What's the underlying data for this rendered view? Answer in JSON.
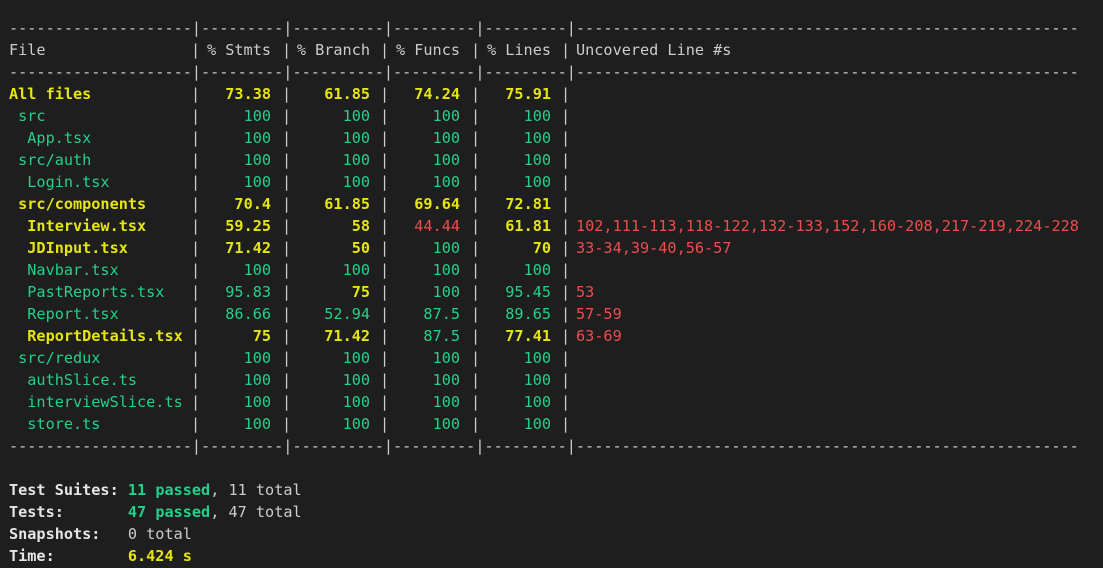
{
  "table": {
    "rule_line": "--------------------|---------|----------|---------|---------|-------------------------------------------------------",
    "headers": [
      "File",
      "% Stmts",
      "% Branch",
      "% Funcs",
      "% Lines",
      "Uncovered Line #s"
    ],
    "rows": [
      {
        "file": "All files",
        "stmts": "73.38",
        "branch": "61.85",
        "funcs": "74.24",
        "lines": "75.91",
        "uncovered": "",
        "colors": {
          "file": "yellow",
          "stmts": "yellow",
          "branch": "yellow",
          "funcs": "yellow",
          "lines": "yellow",
          "uncovered": "red"
        }
      },
      {
        "file": " src",
        "stmts": "100",
        "branch": "100",
        "funcs": "100",
        "lines": "100",
        "uncovered": "",
        "colors": {
          "file": "green",
          "stmts": "green",
          "branch": "green",
          "funcs": "green",
          "lines": "green",
          "uncovered": "red"
        }
      },
      {
        "file": "  App.tsx",
        "stmts": "100",
        "branch": "100",
        "funcs": "100",
        "lines": "100",
        "uncovered": "",
        "colors": {
          "file": "green",
          "stmts": "green",
          "branch": "green",
          "funcs": "green",
          "lines": "green",
          "uncovered": "red"
        }
      },
      {
        "file": " src/auth",
        "stmts": "100",
        "branch": "100",
        "funcs": "100",
        "lines": "100",
        "uncovered": "",
        "colors": {
          "file": "green",
          "stmts": "green",
          "branch": "green",
          "funcs": "green",
          "lines": "green",
          "uncovered": "red"
        }
      },
      {
        "file": "  Login.tsx",
        "stmts": "100",
        "branch": "100",
        "funcs": "100",
        "lines": "100",
        "uncovered": "",
        "colors": {
          "file": "green",
          "stmts": "green",
          "branch": "green",
          "funcs": "green",
          "lines": "green",
          "uncovered": "red"
        }
      },
      {
        "file": " src/components",
        "stmts": "70.4",
        "branch": "61.85",
        "funcs": "69.64",
        "lines": "72.81",
        "uncovered": "",
        "colors": {
          "file": "yellow",
          "stmts": "yellow",
          "branch": "yellow",
          "funcs": "yellow",
          "lines": "yellow",
          "uncovered": "red"
        }
      },
      {
        "file": "  Interview.tsx",
        "stmts": "59.25",
        "branch": "58",
        "funcs": "44.44",
        "lines": "61.81",
        "uncovered": "102,111-113,118-122,132-133,152,160-208,217-219,224-228",
        "colors": {
          "file": "yellow",
          "stmts": "yellow",
          "branch": "yellow",
          "funcs": "red",
          "lines": "yellow",
          "uncovered": "red"
        }
      },
      {
        "file": "  JDInput.tsx",
        "stmts": "71.42",
        "branch": "50",
        "funcs": "100",
        "lines": "70",
        "uncovered": "33-34,39-40,56-57",
        "colors": {
          "file": "yellow",
          "stmts": "yellow",
          "branch": "yellow",
          "funcs": "green",
          "lines": "yellow",
          "uncovered": "red"
        }
      },
      {
        "file": "  Navbar.tsx",
        "stmts": "100",
        "branch": "100",
        "funcs": "100",
        "lines": "100",
        "uncovered": "",
        "colors": {
          "file": "green",
          "stmts": "green",
          "branch": "green",
          "funcs": "green",
          "lines": "green",
          "uncovered": "red"
        }
      },
      {
        "file": "  PastReports.tsx",
        "stmts": "95.83",
        "branch": "75",
        "funcs": "100",
        "lines": "95.45",
        "uncovered": "53",
        "colors": {
          "file": "green",
          "stmts": "green",
          "branch": "yellow",
          "funcs": "green",
          "lines": "green",
          "uncovered": "red"
        }
      },
      {
        "file": "  Report.tsx",
        "stmts": "86.66",
        "branch": "52.94",
        "funcs": "87.5",
        "lines": "89.65",
        "uncovered": "57-59",
        "colors": {
          "file": "green",
          "stmts": "green",
          "branch": "green",
          "funcs": "green",
          "lines": "green",
          "uncovered": "red"
        }
      },
      {
        "file": "  ReportDetails.tsx",
        "stmts": "75",
        "branch": "71.42",
        "funcs": "87.5",
        "lines": "77.41",
        "uncovered": "63-69",
        "colors": {
          "file": "yellow",
          "stmts": "yellow",
          "branch": "yellow",
          "funcs": "green",
          "lines": "yellow",
          "uncovered": "red"
        }
      },
      {
        "file": " src/redux",
        "stmts": "100",
        "branch": "100",
        "funcs": "100",
        "lines": "100",
        "uncovered": "",
        "colors": {
          "file": "green",
          "stmts": "green",
          "branch": "green",
          "funcs": "green",
          "lines": "green",
          "uncovered": "red"
        }
      },
      {
        "file": "  authSlice.ts",
        "stmts": "100",
        "branch": "100",
        "funcs": "100",
        "lines": "100",
        "uncovered": "",
        "colors": {
          "file": "green",
          "stmts": "green",
          "branch": "green",
          "funcs": "green",
          "lines": "green",
          "uncovered": "red"
        }
      },
      {
        "file": "  interviewSlice.ts",
        "stmts": "100",
        "branch": "100",
        "funcs": "100",
        "lines": "100",
        "uncovered": "",
        "colors": {
          "file": "green",
          "stmts": "green",
          "branch": "green",
          "funcs": "green",
          "lines": "green",
          "uncovered": "red"
        }
      },
      {
        "file": "  store.ts",
        "stmts": "100",
        "branch": "100",
        "funcs": "100",
        "lines": "100",
        "uncovered": "",
        "colors": {
          "file": "green",
          "stmts": "green",
          "branch": "green",
          "funcs": "green",
          "lines": "green",
          "uncovered": "red"
        }
      }
    ]
  },
  "summary": {
    "suites_label": "Test Suites:",
    "suites_passed": "11 passed",
    "suites_total": ", 11 total",
    "tests_label": "Tests:",
    "tests_passed": "47 passed",
    "tests_total": ", 47 total",
    "snapshots_label": "Snapshots:",
    "snapshots_value": "0 total",
    "time_label": "Time:",
    "time_value": "6.424 s"
  },
  "colors": {
    "background": "#1e1e1e",
    "text": "#cccccc",
    "yellow": "#e5e510",
    "green": "#23d18b",
    "red": "#f14c4c"
  }
}
